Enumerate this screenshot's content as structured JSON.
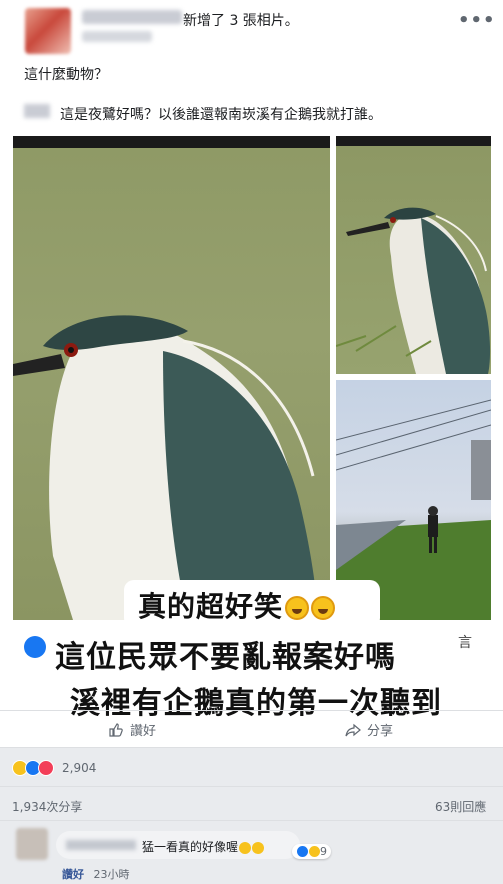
{
  "post": {
    "header_action": "新增了 3 張相片。",
    "more_label": "•••",
    "caption_line1": "這什麼動物？",
    "caption_line2": "這是夜鷺好嗎？以後誰還報南崁溪有企鵝我就打誰。"
  },
  "image_overlay": {
    "line1": "真的超好笑",
    "line2": "這位民眾不要亂報案好嗎",
    "line3": "溪裡有企鵝真的第一次聽到",
    "right_fragment": "言"
  },
  "actions": {
    "like_label": "讚好",
    "share_label": "分享"
  },
  "stats": {
    "reaction_count": "2,904",
    "shares": "1,934次分享",
    "comments": "63則回應"
  },
  "comment": {
    "text": "猛一看真的好像喔",
    "reaction_count": "9",
    "like_label": "讚好",
    "time": "23小時"
  },
  "colors": {
    "accent_blue": "#1877f2",
    "link_blue": "#385898",
    "secondary_text": "#606770"
  }
}
